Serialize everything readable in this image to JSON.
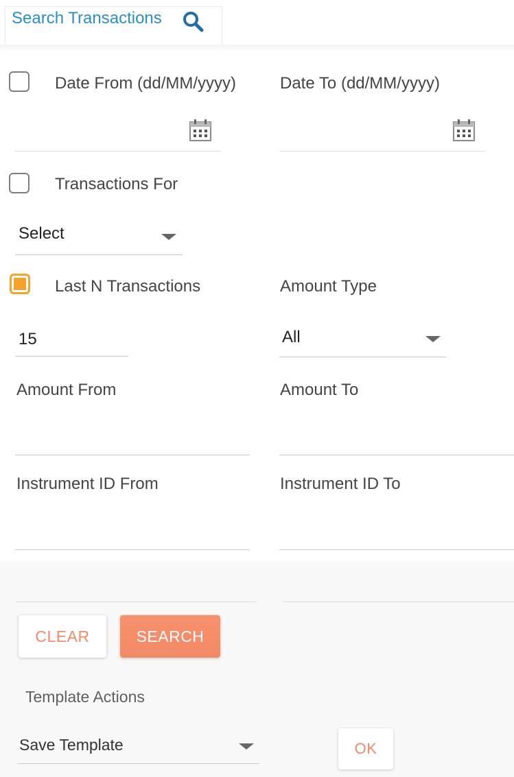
{
  "tab": {
    "label": "Search Transactions",
    "icon": "search-icon",
    "color": "#2a8fc7"
  },
  "fields": {
    "date_from": {
      "label": "Date From (dd/MM/yyyy)",
      "checked": false,
      "icon": "calendar-icon"
    },
    "date_to": {
      "label": "Date To (dd/MM/yyyy)",
      "icon": "calendar-icon"
    },
    "transactions_for": {
      "label": "Transactions For",
      "checked": false,
      "value": "Select"
    },
    "last_n": {
      "label": "Last N Transactions",
      "checked": true,
      "value": "15"
    },
    "amount_type": {
      "label": "Amount Type",
      "value": "All"
    },
    "amount_from": {
      "label": "Amount From",
      "value": ""
    },
    "amount_to": {
      "label": "Amount To",
      "value": ""
    },
    "instrument_from": {
      "label": "Instrument ID From",
      "value": ""
    },
    "instrument_to": {
      "label": "Instrument ID To",
      "value": ""
    }
  },
  "buttons": {
    "clear": "CLEAR",
    "search": "SEARCH",
    "ok": "OK"
  },
  "template_actions": {
    "label": "Template Actions",
    "selected": "Save Template"
  },
  "colors": {
    "accent": "#f6a22d",
    "primary_button": "#f38a67",
    "link": "#2a8fc7"
  }
}
